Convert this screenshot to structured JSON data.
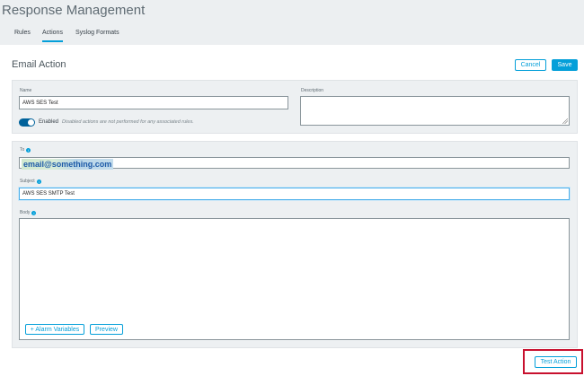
{
  "header": {
    "title": "Response Management"
  },
  "tabs": [
    {
      "label": "Rules"
    },
    {
      "label": "Actions",
      "active": true
    },
    {
      "label": "Syslog Formats"
    }
  ],
  "section": {
    "title": "Email Action"
  },
  "actions": {
    "cancel": "Cancel",
    "save": "Save",
    "test": "Test Action"
  },
  "form": {
    "name_label": "Name",
    "name_value": "AWS SES Test",
    "description_label": "Description",
    "description_value": "",
    "enabled": true,
    "enabled_label": "Enabled",
    "enabled_hint": "Disabled actions are not performed for any associated rules.",
    "to_label": "To",
    "to_value": "email@something.com",
    "subject_label": "Subject",
    "subject_value": "AWS SES SMTP Test",
    "body_label": "Body",
    "body_value": "",
    "alarm_variables": "+ Alarm Variables",
    "preview": "Preview"
  },
  "colors": {
    "accent": "#049fd9",
    "toggle": "#00629b",
    "highlight": "#c8102e"
  },
  "icons": [
    "info-icon",
    "resize-handle-icon"
  ]
}
